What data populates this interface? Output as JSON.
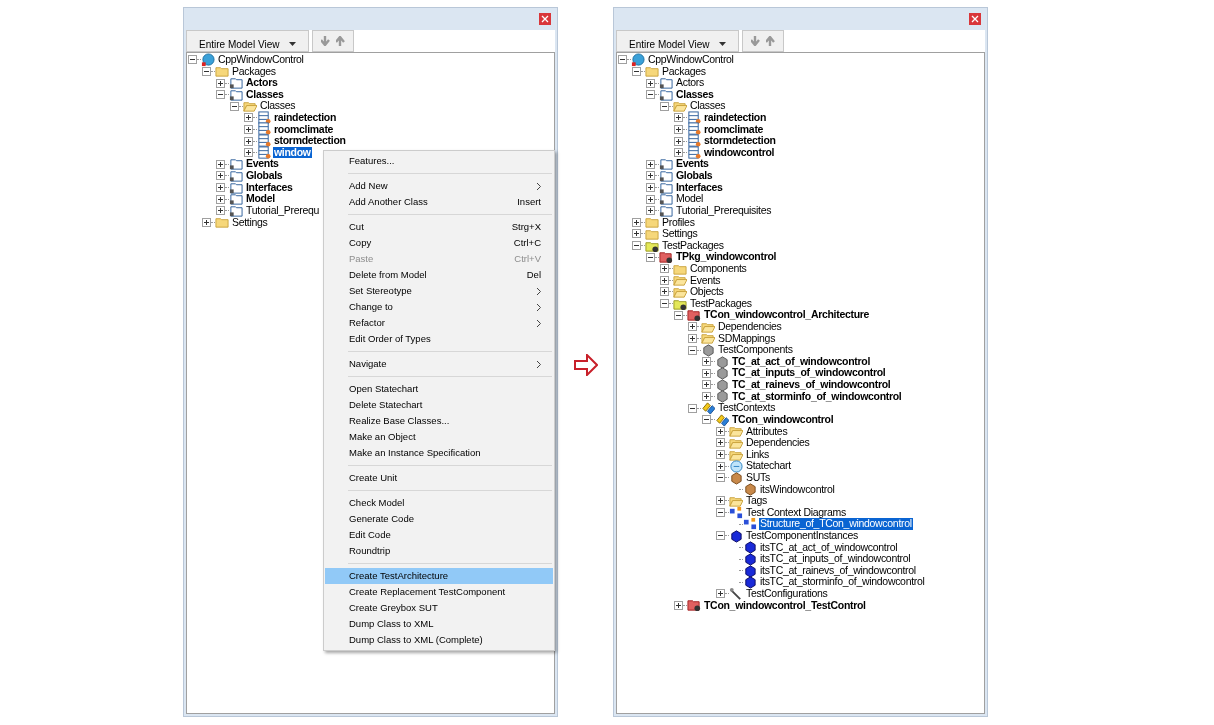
{
  "panels": [
    {
      "view_selector": "Entire Model View",
      "tree": [
        {
          "label": "CppWindowControl",
          "kind": "model",
          "bold": false,
          "selected": false,
          "expanded": true,
          "children": [
            {
              "label": "Packages",
              "kind": "folder",
              "bold": false,
              "selected": false,
              "expanded": true,
              "children": [
                {
                  "label": "Actors",
                  "kind": "package",
                  "bold": true,
                  "selected": false,
                  "expanded": false
                },
                {
                  "label": "Classes",
                  "kind": "package",
                  "bold": true,
                  "selected": false,
                  "expanded": true,
                  "children": [
                    {
                      "label": "Classes",
                      "kind": "openfolder",
                      "bold": false,
                      "selected": false,
                      "expanded": true,
                      "children": [
                        {
                          "label": "raindetection",
                          "kind": "class",
                          "bold": true,
                          "selected": false,
                          "expanded": false
                        },
                        {
                          "label": "roomclimate",
                          "kind": "class",
                          "bold": true,
                          "selected": false,
                          "expanded": false
                        },
                        {
                          "label": "stormdetection",
                          "kind": "class",
                          "bold": true,
                          "selected": false,
                          "expanded": false
                        },
                        {
                          "label": "window",
                          "kind": "class",
                          "bold": true,
                          "selected": true,
                          "expanded": false
                        }
                      ]
                    }
                  ]
                },
                {
                  "label": "Events",
                  "kind": "package",
                  "bold": true,
                  "selected": false,
                  "expanded": false
                },
                {
                  "label": "Globals",
                  "kind": "package",
                  "bold": true,
                  "selected": false,
                  "expanded": false
                },
                {
                  "label": "Interfaces",
                  "kind": "package",
                  "bold": true,
                  "selected": false,
                  "expanded": false
                },
                {
                  "label": "Model",
                  "kind": "package",
                  "bold": true,
                  "selected": false,
                  "expanded": false
                },
                {
                  "label": "Tutorial_Prerequ",
                  "kind": "package",
                  "bold": false,
                  "selected": false,
                  "expanded": false
                }
              ]
            },
            {
              "label": "Settings",
              "kind": "folder",
              "bold": false,
              "selected": false,
              "expanded": false
            }
          ]
        }
      ],
      "context_menu": [
        {
          "kind": "item",
          "label": "Features...",
          "submenu": false,
          "disabled": false,
          "selected": false
        },
        {
          "kind": "separator"
        },
        {
          "kind": "item",
          "label": "Add New",
          "submenu": true,
          "disabled": false,
          "selected": false
        },
        {
          "kind": "item",
          "label": "Add Another Class",
          "shortcut": "Insert",
          "submenu": false,
          "disabled": false,
          "selected": false
        },
        {
          "kind": "separator"
        },
        {
          "kind": "item",
          "label": "Cut",
          "shortcut": "Strg+X",
          "submenu": false,
          "disabled": false,
          "selected": false
        },
        {
          "kind": "item",
          "label": "Copy",
          "shortcut": "Ctrl+C",
          "submenu": false,
          "disabled": false,
          "selected": false
        },
        {
          "kind": "item",
          "label": "Paste",
          "shortcut": "Ctrl+V",
          "submenu": false,
          "disabled": true,
          "selected": false
        },
        {
          "kind": "item",
          "label": "Delete from Model",
          "shortcut": "Del",
          "submenu": false,
          "disabled": false,
          "selected": false
        },
        {
          "kind": "item",
          "label": "Set Stereotype",
          "submenu": true,
          "disabled": false,
          "selected": false
        },
        {
          "kind": "item",
          "label": "Change to",
          "submenu": true,
          "disabled": false,
          "selected": false
        },
        {
          "kind": "item",
          "label": "Refactor",
          "submenu": true,
          "disabled": false,
          "selected": false
        },
        {
          "kind": "item",
          "label": "Edit Order of Types",
          "submenu": false,
          "disabled": false,
          "selected": false
        },
        {
          "kind": "separator"
        },
        {
          "kind": "item",
          "label": "Navigate",
          "submenu": true,
          "disabled": false,
          "selected": false
        },
        {
          "kind": "separator"
        },
        {
          "kind": "item",
          "label": "Open Statechart",
          "submenu": false,
          "disabled": false,
          "selected": false
        },
        {
          "kind": "item",
          "label": "Delete Statechart",
          "submenu": false,
          "disabled": false,
          "selected": false
        },
        {
          "kind": "item",
          "label": "Realize Base Classes...",
          "submenu": false,
          "disabled": false,
          "selected": false
        },
        {
          "kind": "item",
          "label": "Make an Object",
          "submenu": false,
          "disabled": false,
          "selected": false
        },
        {
          "kind": "item",
          "label": "Make an Instance Specification",
          "submenu": false,
          "disabled": false,
          "selected": false
        },
        {
          "kind": "separator"
        },
        {
          "kind": "item",
          "label": "Create Unit",
          "submenu": false,
          "disabled": false,
          "selected": false
        },
        {
          "kind": "separator"
        },
        {
          "kind": "item",
          "label": "Check Model",
          "submenu": false,
          "disabled": false,
          "selected": false
        },
        {
          "kind": "item",
          "label": "Generate Code",
          "submenu": false,
          "disabled": false,
          "selected": false
        },
        {
          "kind": "item",
          "label": "Edit Code",
          "submenu": false,
          "disabled": false,
          "selected": false
        },
        {
          "kind": "item",
          "label": "Roundtrip",
          "submenu": false,
          "disabled": false,
          "selected": false
        },
        {
          "kind": "separator"
        },
        {
          "kind": "item",
          "label": "Create TestArchitecture",
          "submenu": false,
          "disabled": false,
          "selected": true
        },
        {
          "kind": "item",
          "label": "Create Replacement TestComponent",
          "submenu": false,
          "disabled": false,
          "selected": false
        },
        {
          "kind": "item",
          "label": "Create Greybox SUT",
          "submenu": false,
          "disabled": false,
          "selected": false
        },
        {
          "kind": "item",
          "label": "Dump Class to XML",
          "submenu": false,
          "disabled": false,
          "selected": false
        },
        {
          "kind": "item",
          "label": "Dump Class to XML (Complete)",
          "submenu": false,
          "disabled": false,
          "selected": false
        }
      ]
    },
    {
      "view_selector": "Entire Model View",
      "tree": [
        {
          "label": "CppWindowControl",
          "kind": "model",
          "bold": false,
          "selected": false,
          "expanded": true,
          "children": [
            {
              "label": "Packages",
              "kind": "folder",
              "bold": false,
              "selected": false,
              "expanded": true,
              "children": [
                {
                  "label": "Actors",
                  "kind": "package",
                  "bold": false,
                  "selected": false,
                  "expanded": false
                },
                {
                  "label": "Classes",
                  "kind": "package",
                  "bold": true,
                  "selected": false,
                  "expanded": true,
                  "children": [
                    {
                      "label": "Classes",
                      "kind": "openfolder",
                      "bold": false,
                      "selected": false,
                      "expanded": true,
                      "children": [
                        {
                          "label": "raindetection",
                          "kind": "class",
                          "bold": true,
                          "selected": false,
                          "expanded": false
                        },
                        {
                          "label": "roomclimate",
                          "kind": "class",
                          "bold": true,
                          "selected": false,
                          "expanded": false
                        },
                        {
                          "label": "stormdetection",
                          "kind": "class",
                          "bold": true,
                          "selected": false,
                          "expanded": false
                        },
                        {
                          "label": "windowcontrol",
                          "kind": "class",
                          "bold": true,
                          "selected": false,
                          "expanded": false
                        }
                      ]
                    }
                  ]
                },
                {
                  "label": "Events",
                  "kind": "package",
                  "bold": true,
                  "selected": false,
                  "expanded": false
                },
                {
                  "label": "Globals",
                  "kind": "package",
                  "bold": true,
                  "selected": false,
                  "expanded": false
                },
                {
                  "label": "Interfaces",
                  "kind": "package",
                  "bold": true,
                  "selected": false,
                  "expanded": false
                },
                {
                  "label": "Model",
                  "kind": "package",
                  "bold": false,
                  "selected": false,
                  "expanded": false
                },
                {
                  "label": "Tutorial_Prerequisites",
                  "kind": "package",
                  "bold": false,
                  "selected": false,
                  "expanded": false
                }
              ]
            },
            {
              "label": "Profiles",
              "kind": "folder",
              "bold": false,
              "selected": false,
              "expanded": false
            },
            {
              "label": "Settings",
              "kind": "folder",
              "bold": false,
              "selected": false,
              "expanded": false
            },
            {
              "label": "TestPackages",
              "kind": "testfolder",
              "bold": false,
              "selected": false,
              "expanded": true,
              "children": [
                {
                  "label": "TPkg_windowcontrol",
                  "kind": "testpackage",
                  "bold": true,
                  "selected": false,
                  "expanded": true,
                  "children": [
                    {
                      "label": "Components",
                      "kind": "folder",
                      "bold": false,
                      "selected": false,
                      "expanded": false
                    },
                    {
                      "label": "Events",
                      "kind": "openfolder",
                      "bold": false,
                      "selected": false,
                      "expanded": false
                    },
                    {
                      "label": "Objects",
                      "kind": "openfolder",
                      "bold": false,
                      "selected": false,
                      "expanded": false
                    },
                    {
                      "label": "TestPackages",
                      "kind": "testfolder",
                      "bold": false,
                      "selected": false,
                      "expanded": true,
                      "children": [
                        {
                          "label": "TCon_windowcontrol_Architecture",
                          "kind": "testpackage",
                          "bold": true,
                          "selected": false,
                          "expanded": true,
                          "children": [
                            {
                              "label": "Dependencies",
                              "kind": "openfolder",
                              "bold": false,
                              "selected": false,
                              "expanded": false
                            },
                            {
                              "label": "SDMappings",
                              "kind": "openfolder",
                              "bold": false,
                              "selected": false,
                              "expanded": false
                            },
                            {
                              "label": "TestComponents",
                              "kind": "component",
                              "bold": false,
                              "selected": false,
                              "expanded": true,
                              "children": [
                                {
                                  "label": "TC_at_act_of_windowcontrol",
                                  "kind": "component",
                                  "bold": true,
                                  "selected": false,
                                  "expanded": false
                                },
                                {
                                  "label": "TC_at_inputs_of_windowcontrol",
                                  "kind": "component",
                                  "bold": true,
                                  "selected": false,
                                  "expanded": false
                                },
                                {
                                  "label": "TC_at_rainevs_of_windowcontrol",
                                  "kind": "component",
                                  "bold": true,
                                  "selected": false,
                                  "expanded": false
                                },
                                {
                                  "label": "TC_at_storminfo_of_windowcontrol",
                                  "kind": "component",
                                  "bold": true,
                                  "selected": false,
                                  "expanded": false
                                }
                              ]
                            },
                            {
                              "label": "TestContexts",
                              "kind": "context",
                              "bold": false,
                              "selected": false,
                              "expanded": true,
                              "children": [
                                {
                                  "label": "TCon_windowcontrol",
                                  "kind": "context",
                                  "bold": true,
                                  "selected": false,
                                  "expanded": true,
                                  "children": [
                                    {
                                      "label": "Attributes",
                                      "kind": "openfolder",
                                      "bold": false,
                                      "selected": false,
                                      "expanded": false
                                    },
                                    {
                                      "label": "Dependencies",
                                      "kind": "openfolder",
                                      "bold": false,
                                      "selected": false,
                                      "expanded": false
                                    },
                                    {
                                      "label": "Links",
                                      "kind": "openfolder",
                                      "bold": false,
                                      "selected": false,
                                      "expanded": false
                                    },
                                    {
                                      "label": "Statechart",
                                      "kind": "statechart",
                                      "bold": false,
                                      "selected": false,
                                      "expanded": false
                                    },
                                    {
                                      "label": "SUTs",
                                      "kind": "sut",
                                      "bold": false,
                                      "selected": false,
                                      "expanded": true,
                                      "children": [
                                        {
                                          "label": "itsWindowcontrol",
                                          "kind": "sut",
                                          "bold": false,
                                          "selected": false
                                        }
                                      ]
                                    },
                                    {
                                      "label": "Tags",
                                      "kind": "openfolder",
                                      "bold": false,
                                      "selected": false,
                                      "expanded": false
                                    },
                                    {
                                      "label": "Test Context Diagrams",
                                      "kind": "diagram",
                                      "bold": false,
                                      "selected": false,
                                      "expanded": true,
                                      "children": [
                                        {
                                          "label": "Structure_of_TCon_windowcontrol",
                                          "kind": "diagram",
                                          "bold": false,
                                          "selected": true
                                        }
                                      ]
                                    },
                                    {
                                      "label": "TestComponentInstances",
                                      "kind": "instance",
                                      "bold": false,
                                      "selected": false,
                                      "expanded": true,
                                      "children": [
                                        {
                                          "label": "itsTC_at_act_of_windowcontrol",
                                          "kind": "instance",
                                          "bold": false,
                                          "selected": false
                                        },
                                        {
                                          "label": "itsTC_at_inputs_of_windowcontrol",
                                          "kind": "instance",
                                          "bold": false,
                                          "selected": false
                                        },
                                        {
                                          "label": "itsTC_at_rainevs_of_windowcontrol",
                                          "kind": "instance",
                                          "bold": false,
                                          "selected": false
                                        },
                                        {
                                          "label": "itsTC_at_storminfo_of_windowcontrol",
                                          "kind": "instance",
                                          "bold": false,
                                          "selected": false
                                        }
                                      ]
                                    },
                                    {
                                      "label": "TestConfigurations",
                                      "kind": "config",
                                      "bold": false,
                                      "selected": false,
                                      "expanded": false
                                    }
                                  ]
                                }
                              ]
                            }
                          ]
                        },
                        {
                          "label": "TCon_windowcontrol_TestControl",
                          "kind": "testpackage",
                          "bold": true,
                          "selected": false,
                          "expanded": false
                        }
                      ]
                    }
                  ]
                }
              ]
            }
          ]
        }
      ]
    }
  ]
}
